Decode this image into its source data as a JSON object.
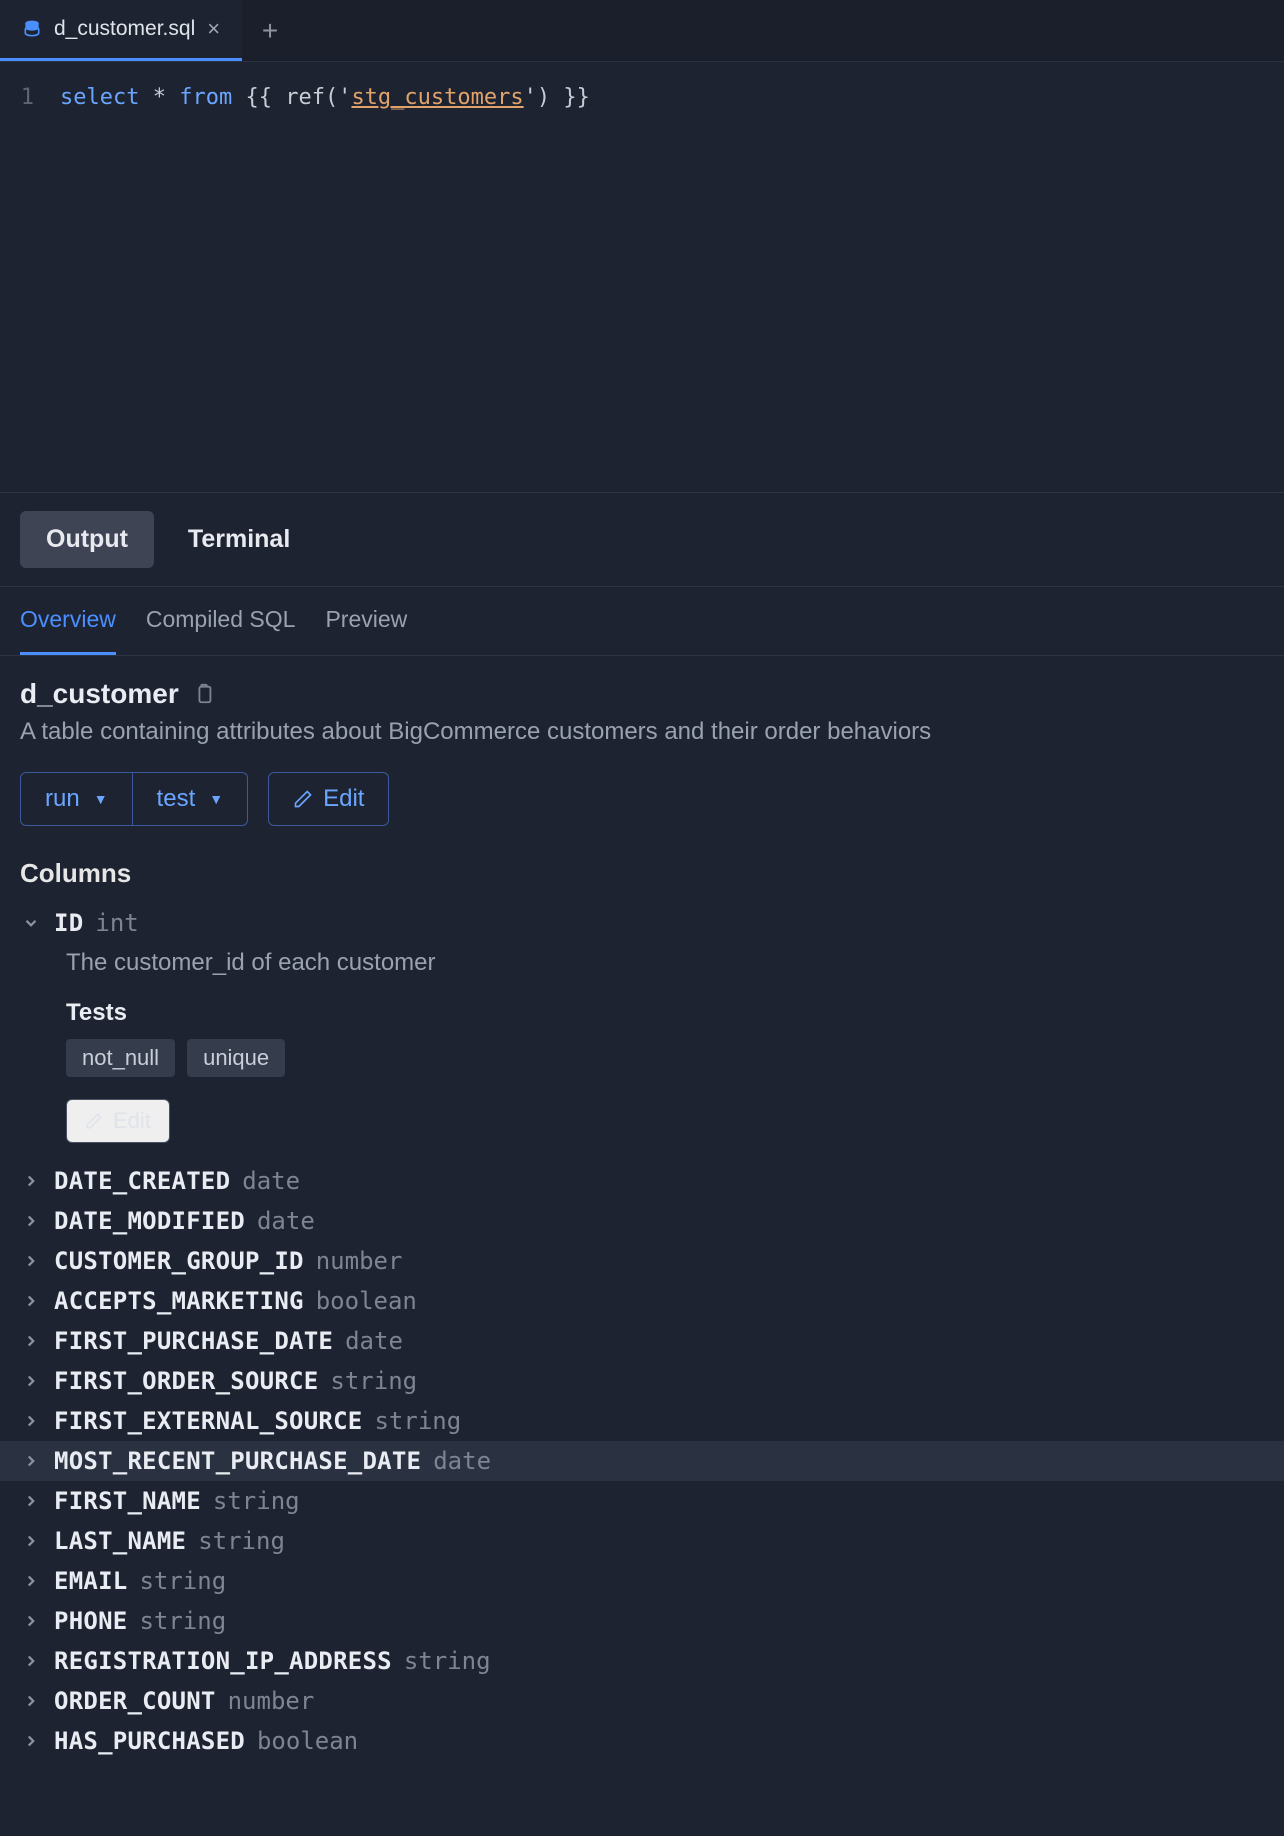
{
  "tabs": {
    "file_name": "d_customer.sql"
  },
  "editor": {
    "line_number": "1",
    "code": {
      "select": "select",
      "star": "*",
      "from": "from",
      "open": "{{ ref('",
      "ref": "stg_customers",
      "close": "') }}"
    }
  },
  "panel_tabs": {
    "output": "Output",
    "terminal": "Terminal"
  },
  "sub_tabs": {
    "overview": "Overview",
    "compiled": "Compiled SQL",
    "preview": "Preview"
  },
  "model": {
    "name": "d_customer",
    "description": "A table containing attributes about BigCommerce customers and their order behaviors"
  },
  "actions": {
    "run": "run",
    "test": "test",
    "edit": "Edit"
  },
  "columns_title": "Columns",
  "expanded": {
    "name": "ID",
    "type": "int",
    "description": "The customer_id of each customer",
    "tests_label": "Tests",
    "tests": [
      "not_null",
      "unique"
    ],
    "edit_label": "Edit"
  },
  "columns": [
    {
      "name": "DATE_CREATED",
      "type": "date"
    },
    {
      "name": "DATE_MODIFIED",
      "type": "date"
    },
    {
      "name": "CUSTOMER_GROUP_ID",
      "type": "number"
    },
    {
      "name": "ACCEPTS_MARKETING",
      "type": "boolean"
    },
    {
      "name": "FIRST_PURCHASE_DATE",
      "type": "date"
    },
    {
      "name": "FIRST_ORDER_SOURCE",
      "type": "string"
    },
    {
      "name": "FIRST_EXTERNAL_SOURCE",
      "type": "string"
    },
    {
      "name": "MOST_RECENT_PURCHASE_DATE",
      "type": "date",
      "highlight": true
    },
    {
      "name": "FIRST_NAME",
      "type": "string"
    },
    {
      "name": "LAST_NAME",
      "type": "string"
    },
    {
      "name": "EMAIL",
      "type": "string"
    },
    {
      "name": "PHONE",
      "type": "string"
    },
    {
      "name": "REGISTRATION_IP_ADDRESS",
      "type": "string"
    },
    {
      "name": "ORDER_COUNT",
      "type": "number"
    },
    {
      "name": "HAS_PURCHASED",
      "type": "boolean"
    }
  ]
}
